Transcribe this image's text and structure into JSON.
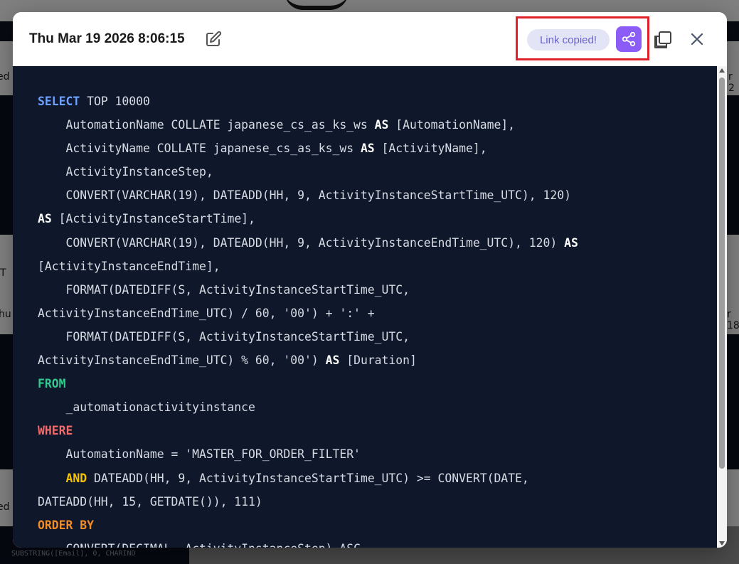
{
  "modal": {
    "title": "Thu Mar 19 2026 8:06:15",
    "link_copied_label": "Link copied!",
    "icons": {
      "edit": "edit-icon",
      "share": "share-icon",
      "copy": "copy-icon",
      "close": "close-icon"
    }
  },
  "code": {
    "lines": [
      [
        {
          "t": "SELECT",
          "c": "kw-blue"
        },
        {
          "t": " TOP 10000"
        }
      ],
      [
        {
          "t": "    AutomationName COLLATE japanese_cs_as_ks_ws "
        },
        {
          "t": "AS",
          "c": "kw-white"
        },
        {
          "t": " [AutomationName],"
        }
      ],
      [
        {
          "t": "    ActivityName COLLATE japanese_cs_as_ks_ws "
        },
        {
          "t": "AS",
          "c": "kw-white"
        },
        {
          "t": " [ActivityName],"
        }
      ],
      [
        {
          "t": "    ActivityInstanceStep,"
        }
      ],
      [
        {
          "t": "    CONVERT(VARCHAR(19), DATEADD(HH, 9, ActivityInstanceStartTime_UTC), 120)"
        }
      ],
      [
        {
          "t": "AS",
          "c": "kw-white"
        },
        {
          "t": " [ActivityInstanceStartTime],"
        }
      ],
      [
        {
          "t": "    CONVERT(VARCHAR(19), DATEADD(HH, 9, ActivityInstanceEndTime_UTC), 120) "
        },
        {
          "t": "AS",
          "c": "kw-white"
        }
      ],
      [
        {
          "t": "[ActivityInstanceEndTime],"
        }
      ],
      [
        {
          "t": "    FORMAT(DATEDIFF(S, ActivityInstanceStartTime_UTC,"
        }
      ],
      [
        {
          "t": "ActivityInstanceEndTime_UTC) / 60, '00') + ':' +"
        }
      ],
      [
        {
          "t": "    FORMAT(DATEDIFF(S, ActivityInstanceStartTime_UTC,"
        }
      ],
      [
        {
          "t": "ActivityInstanceEndTime_UTC) % 60, '00') "
        },
        {
          "t": "AS",
          "c": "kw-white"
        },
        {
          "t": " [Duration]"
        }
      ],
      [
        {
          "t": "FROM",
          "c": "kw-green"
        }
      ],
      [
        {
          "t": "    _automationactivityinstance"
        }
      ],
      [
        {
          "t": "WHERE",
          "c": "kw-red"
        }
      ],
      [
        {
          "t": "    AutomationName = 'MASTER_FOR_ORDER_FILTER'"
        }
      ],
      [
        {
          "t": "    "
        },
        {
          "t": "AND",
          "c": "kw-yellow"
        },
        {
          "t": " DATEADD(HH, 9, ActivityInstanceStartTime_UTC) >= CONVERT(DATE,"
        }
      ],
      [
        {
          "t": "DATEADD(HH, 15, GETDATE()), 111)"
        }
      ],
      [
        {
          "t": "ORDER BY",
          "c": "kw-orange"
        }
      ],
      [
        {
          "t": "    CONVERT(DECIMAL, ActivityInstanceStep) ASC"
        }
      ]
    ]
  },
  "background": {
    "fragments": [
      "ed",
      "T",
      "hu",
      "ed",
      "r 2",
      "r 18",
      "SUBSTRING([Email], 0, CHARIND"
    ]
  }
}
